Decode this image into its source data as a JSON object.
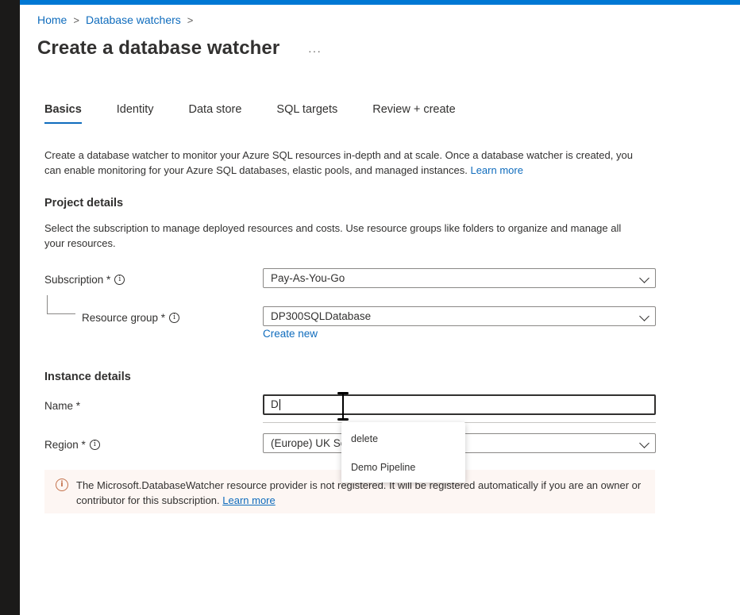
{
  "breadcrumb": {
    "home": "Home",
    "database_watchers": "Database watchers",
    "separator": ">"
  },
  "page": {
    "title": "Create a database watcher",
    "more": "···"
  },
  "tabs": [
    {
      "label": "Basics",
      "active": true
    },
    {
      "label": "Identity",
      "active": false
    },
    {
      "label": "Data store",
      "active": false
    },
    {
      "label": "SQL targets",
      "active": false
    },
    {
      "label": "Review + create",
      "active": false
    }
  ],
  "intro": {
    "text": "Create a database watcher to monitor your Azure SQL resources in-depth and at scale. Once a database watcher is created, you can enable monitoring for your Azure SQL databases, elastic pools, and managed instances.",
    "link": "Learn more"
  },
  "project_details": {
    "title": "Project details",
    "description": "Select the subscription to manage deployed resources and costs. Use resource groups like folders to organize and manage all your resources.",
    "subscription_label": "Subscription *",
    "subscription_value": "Pay-As-You-Go",
    "resource_group_label": "Resource group *",
    "resource_group_value": "DP300SQLDatabase",
    "create_new": "Create new"
  },
  "instance_details": {
    "title": "Instance details",
    "name_label": "Name *",
    "name_value": "D",
    "region_label": "Region *",
    "region_value": "(Europe) UK So"
  },
  "autocomplete": {
    "items": [
      "delete",
      "Demo Pipeline"
    ]
  },
  "warning": {
    "text": "The Microsoft.DatabaseWatcher resource provider is not registered. It will be registered automatically if you are an owner or contributor for this subscription.",
    "link": "Learn more"
  },
  "icons": {
    "info": "info-icon",
    "chevron": "chevron-down-icon",
    "warning": "warning-icon"
  },
  "colors": {
    "accent": "#0f6cbd",
    "top_bar": "#0078d4",
    "warning_bg": "#fdf6f3"
  }
}
